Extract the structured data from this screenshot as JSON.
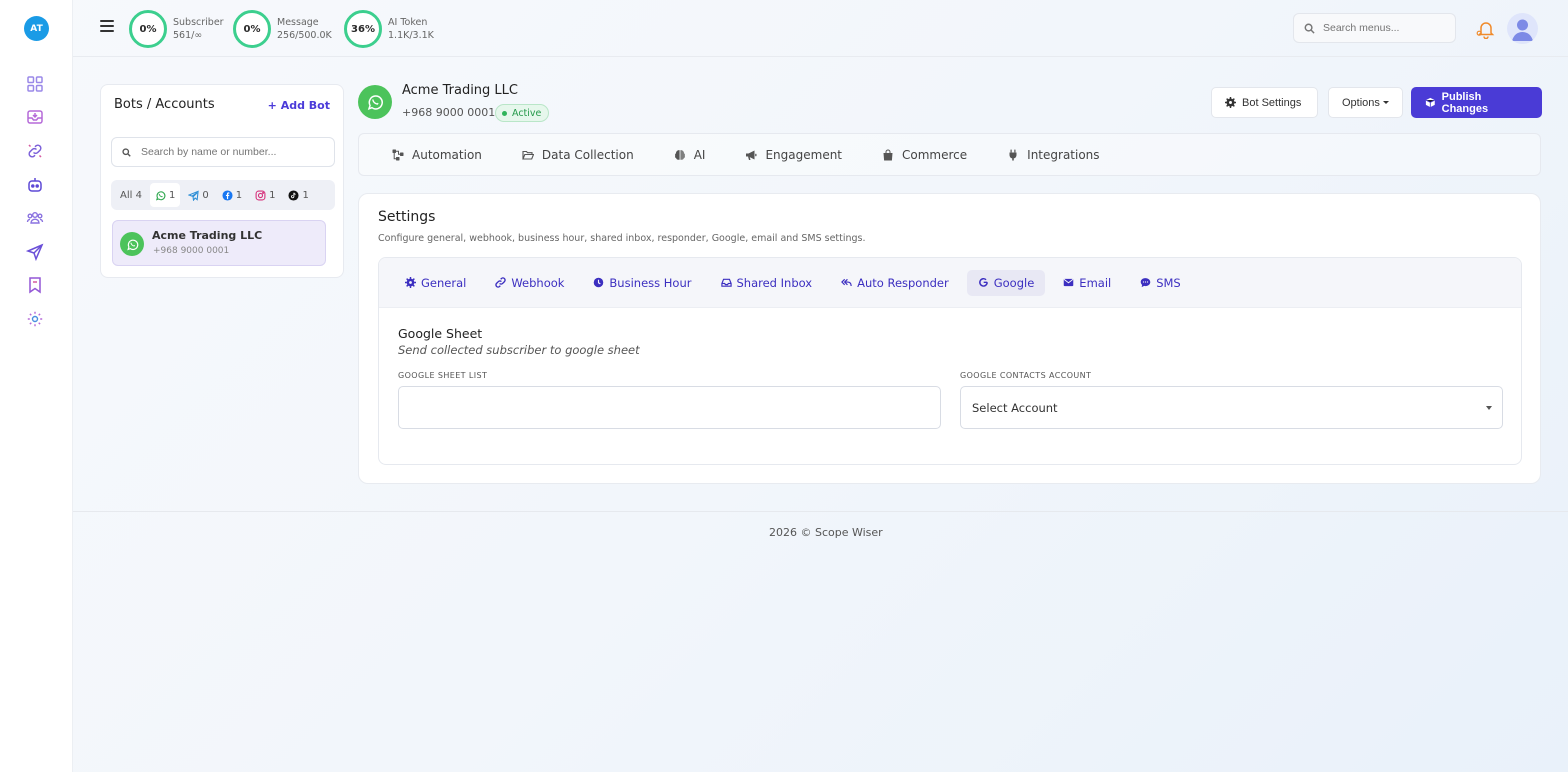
{
  "app": {
    "brand_initials": "AT",
    "accent_color": "#4a3bd6",
    "success_color": "#3ccf8e"
  },
  "rail": {
    "icons": [
      "dashboard-icon",
      "inbox-icon",
      "integrations-link-icon",
      "bot-icon",
      "subscribers-icon",
      "broadcast-send-icon",
      "bookmark-icon",
      "settings-icon"
    ]
  },
  "topbar": {
    "stats": [
      {
        "percent": "0%",
        "label": "Subscriber",
        "value": "561/∞"
      },
      {
        "percent": "0%",
        "label": "Message",
        "value": "256/500.0K"
      },
      {
        "percent": "36%",
        "label": "AI Token",
        "value": "1.1K/3.1K"
      }
    ],
    "search_placeholder": "Search menus..."
  },
  "bots_panel": {
    "title": "Bots / Accounts",
    "add_label": "+ Add Bot",
    "search_placeholder": "Search by name or number...",
    "filters": [
      {
        "label": "All 4",
        "icon": ""
      },
      {
        "label": "1",
        "icon": "whatsapp-icon"
      },
      {
        "label": "0",
        "icon": "telegram-icon"
      },
      {
        "label": "1",
        "icon": "facebook-icon"
      },
      {
        "label": "1",
        "icon": "instagram-icon"
      },
      {
        "label": "1",
        "icon": "tiktok-icon"
      }
    ],
    "items": [
      {
        "name": "Acme Trading LLC",
        "phone": "+968 9000 0001"
      }
    ]
  },
  "bot_header": {
    "name": "Acme Trading LLC",
    "phone": "+968 9000 0001",
    "status": "Active",
    "bot_settings_label": "Bot Settings",
    "options_label": "Options",
    "publish_label": "Publish Changes"
  },
  "category_tabs": [
    {
      "label": "Automation"
    },
    {
      "label": "Data Collection"
    },
    {
      "label": "AI"
    },
    {
      "label": "Engagement"
    },
    {
      "label": "Commerce"
    },
    {
      "label": "Integrations"
    }
  ],
  "settings": {
    "title": "Settings",
    "subtitle": "Configure general, webhook, business hour, shared inbox, responder, Google, email and SMS settings.",
    "tabs": [
      {
        "label": "General"
      },
      {
        "label": "Webhook"
      },
      {
        "label": "Business Hour"
      },
      {
        "label": "Shared Inbox"
      },
      {
        "label": "Auto Responder"
      },
      {
        "label": "Google"
      },
      {
        "label": "Email"
      },
      {
        "label": "SMS"
      }
    ],
    "active_tab": "Google",
    "section_title": "Google Sheet",
    "section_desc": "Send collected subscriber to google sheet",
    "sheet_list_label": "GOOGLE SHEET LIST",
    "sheet_list_value": "",
    "contacts_label": "GOOGLE CONTACTS ACCOUNT",
    "contacts_value": "Select Account"
  },
  "footer": {
    "text": "2026 © Scope Wiser"
  }
}
